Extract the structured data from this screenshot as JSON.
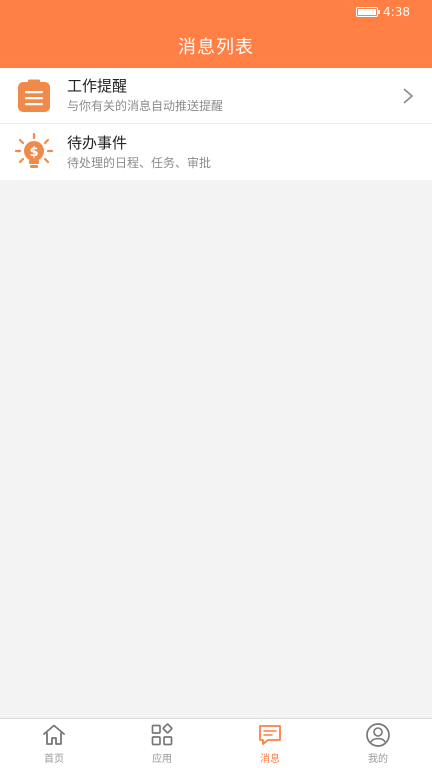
{
  "statusbar": {
    "time": "4:38"
  },
  "header": {
    "title": "消息列表"
  },
  "list": {
    "items": [
      {
        "title": "工作提醒",
        "subtitle": "与你有关的消息自动推送提醒",
        "icon": "clipboard-icon"
      },
      {
        "title": "待办事件",
        "subtitle": "待处理的日程、任务、审批",
        "icon": "lightbulb-money-icon"
      }
    ]
  },
  "tabbar": {
    "tabs": [
      {
        "label": "首页",
        "icon": "home-icon"
      },
      {
        "label": "应用",
        "icon": "apps-icon"
      },
      {
        "label": "消息",
        "icon": "message-icon",
        "active": true
      },
      {
        "label": "我的",
        "icon": "profile-icon"
      }
    ]
  },
  "colors": {
    "accent": "#ff7f45",
    "background": "#f3f3f3",
    "inactive": "#999999"
  }
}
